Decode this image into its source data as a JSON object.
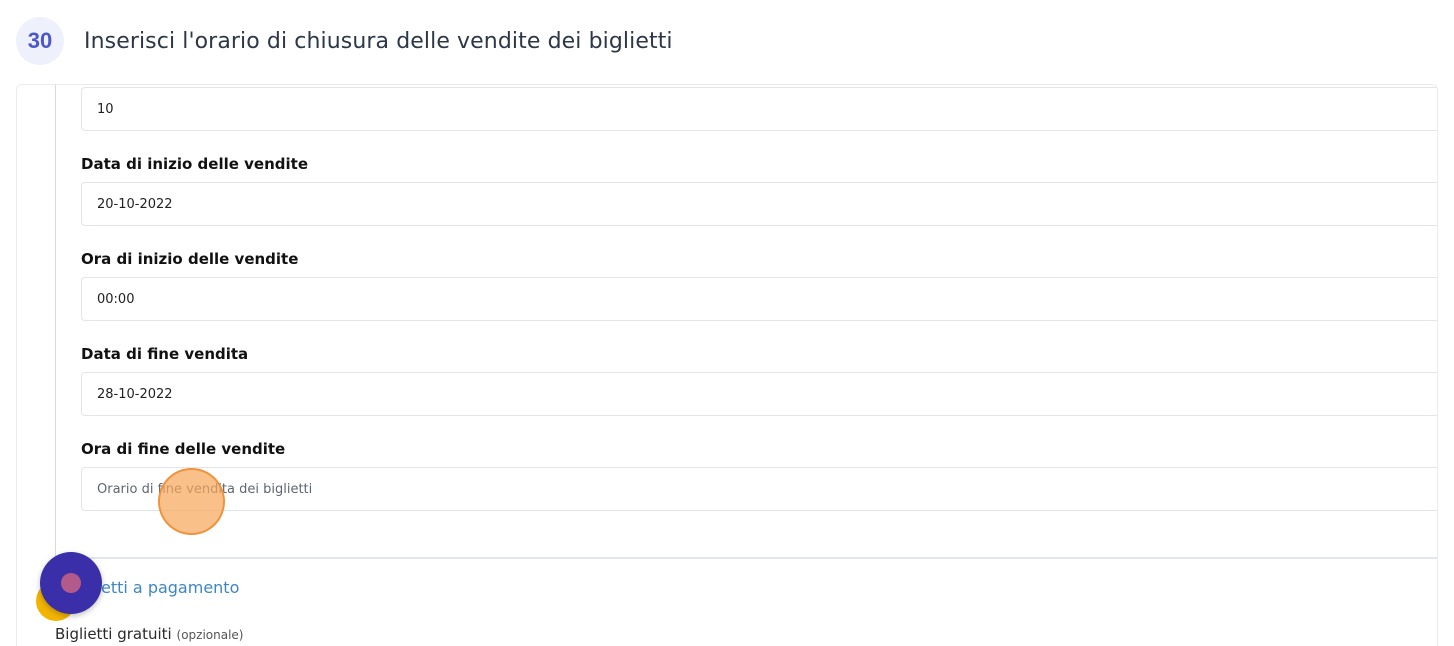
{
  "step": {
    "number": "30",
    "title": "Inserisci l'orario di chiusura delle vendite dei biglietti"
  },
  "form": {
    "quantity_value": "10",
    "sale_start_date": {
      "label": "Data di inizio delle vendite",
      "value": "20-10-2022"
    },
    "sale_start_time": {
      "label": "Ora di inizio delle vendite",
      "value": "00:00"
    },
    "sale_end_date": {
      "label": "Data di fine vendita",
      "value": "28-10-2022"
    },
    "sale_end_time": {
      "label": "Ora di fine delle vendite",
      "placeholder": "Orario di fine vendita dei biglietti"
    }
  },
  "sections": {
    "paid_tickets_link": "etti a pagamento",
    "free_tickets_label": "Biglietti gratuiti",
    "free_tickets_optional": "(opzionale)"
  },
  "colors": {
    "badge_text": "#4b57c9",
    "link": "#3d86c6",
    "chat_bubble": "#3a2fa8",
    "click_marker": "#f7a85c"
  },
  "icons": {
    "chat": "chat-bubble-icon",
    "section": "yellow-circle-icon"
  }
}
